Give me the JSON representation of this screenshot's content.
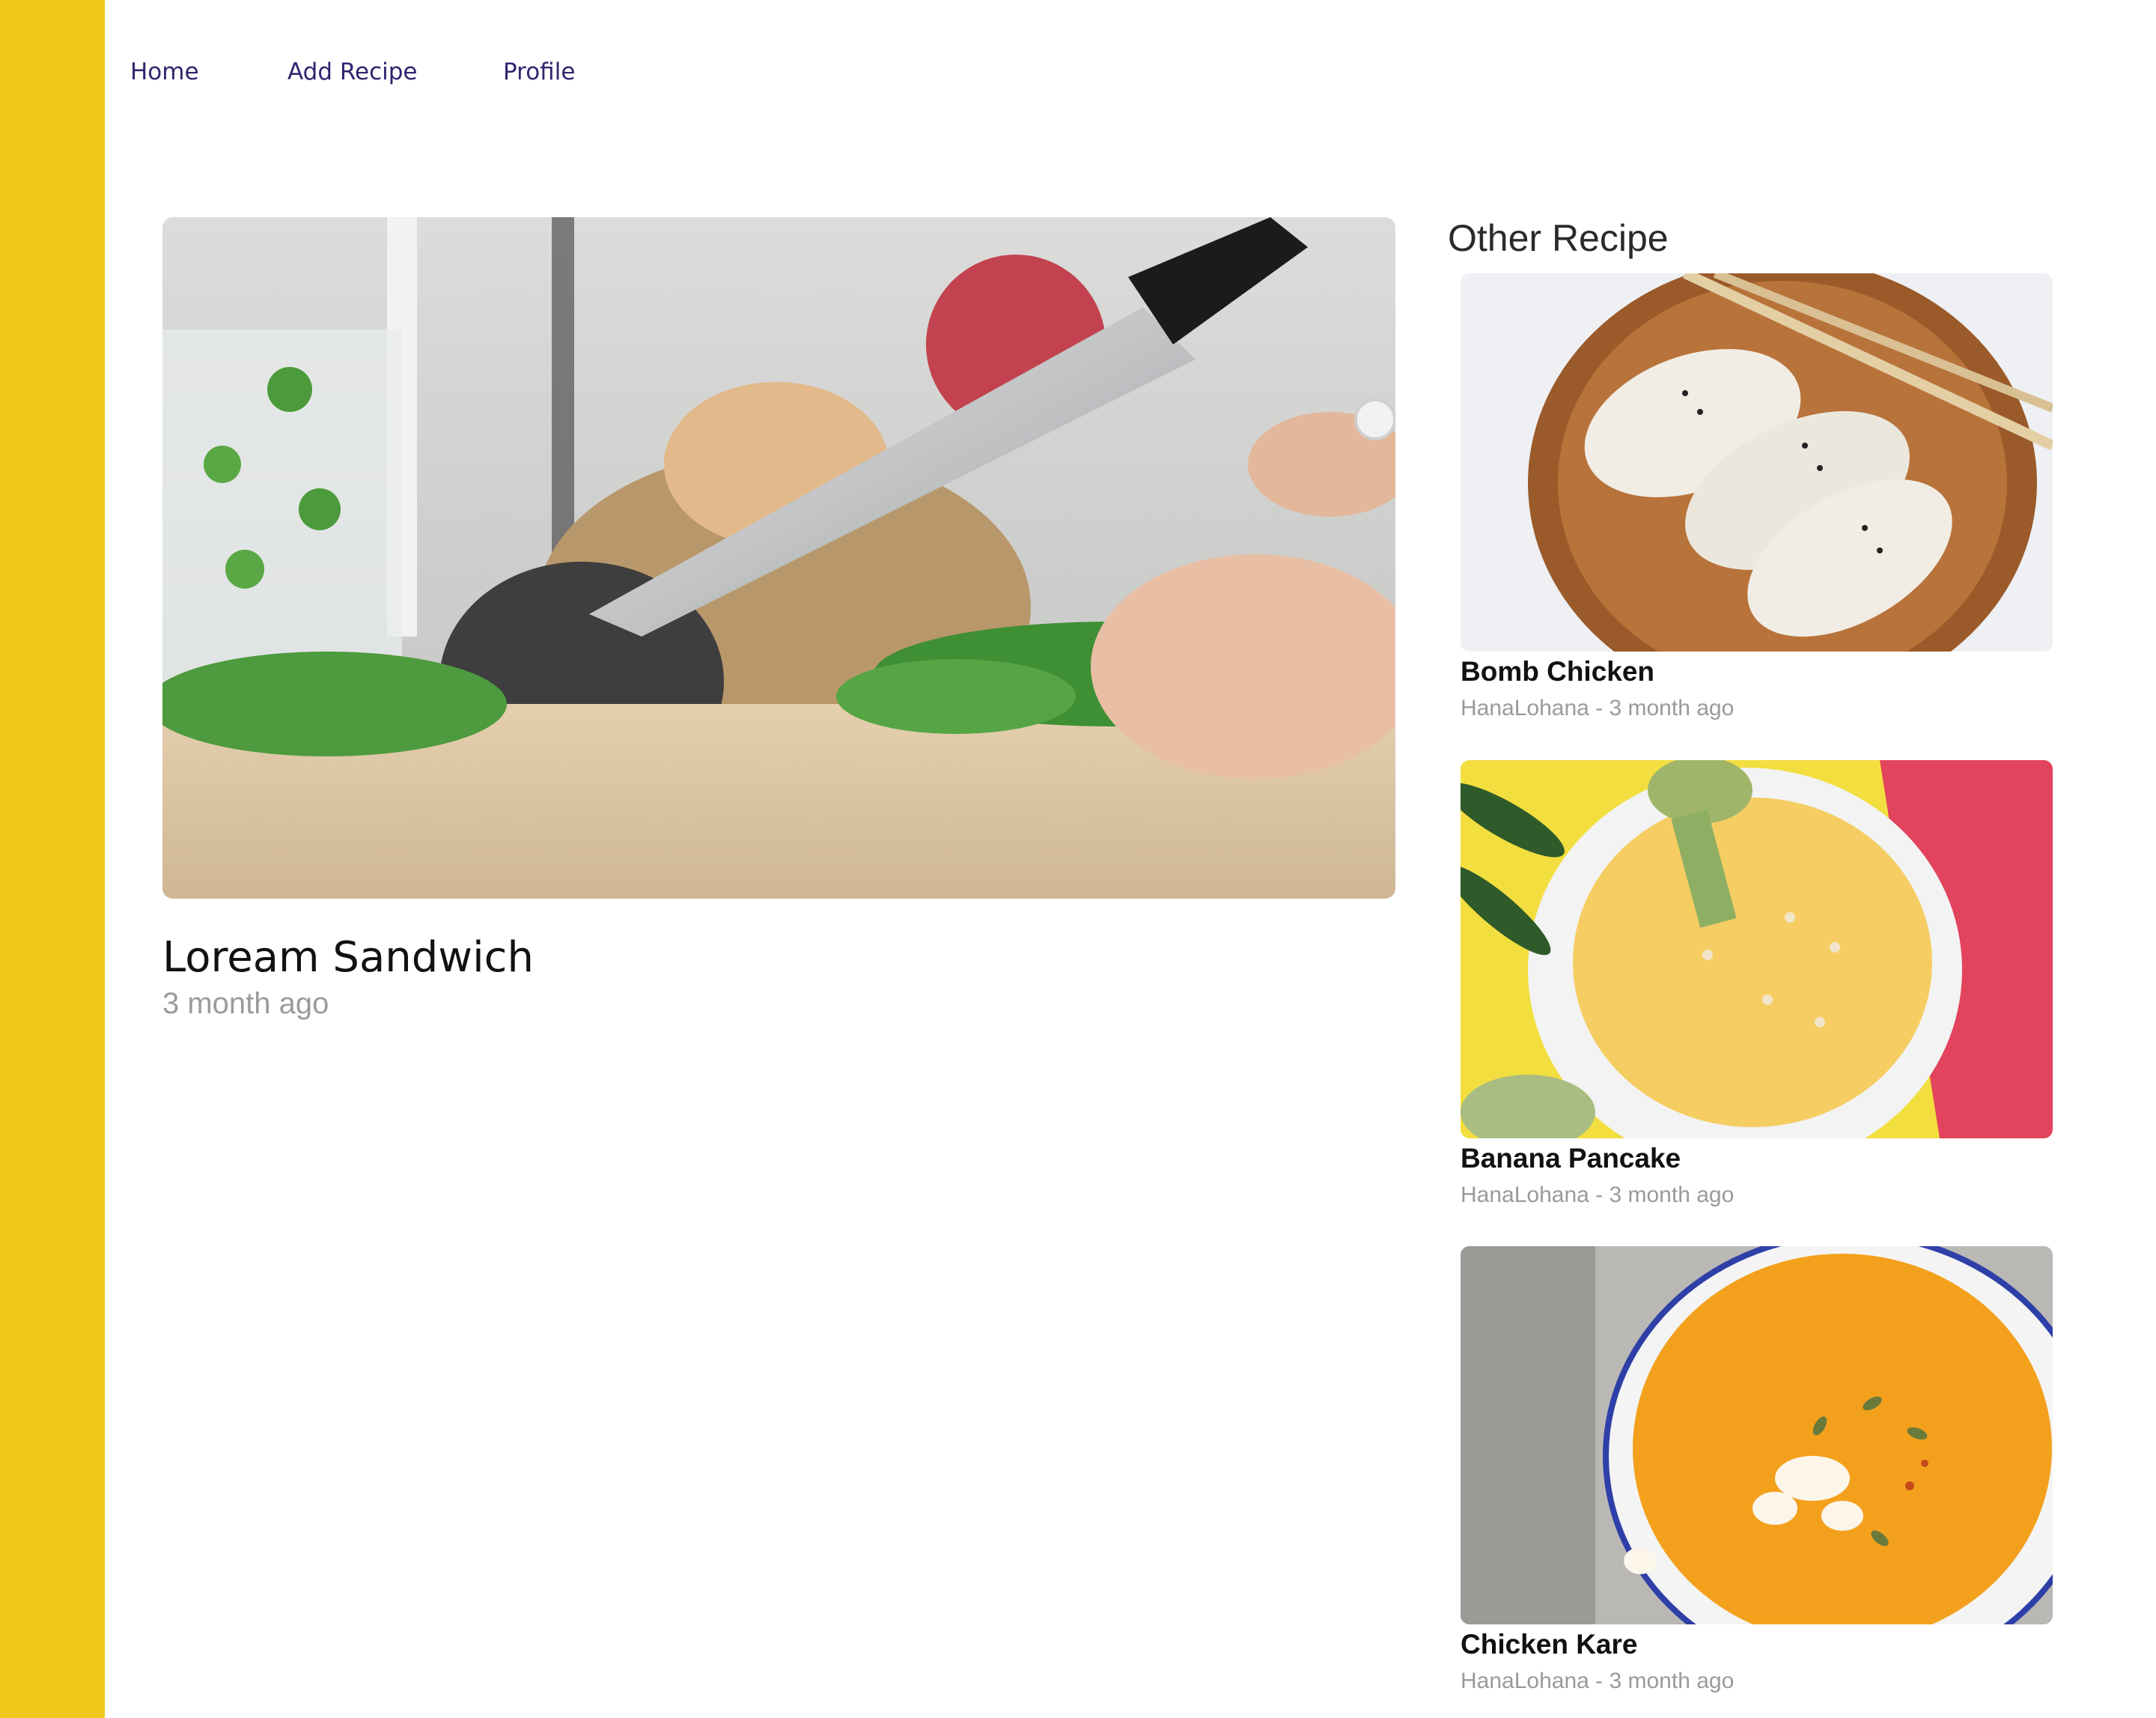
{
  "nav": {
    "home": "Home",
    "add_recipe": "Add Recipe",
    "profile": "Profile"
  },
  "featured": {
    "title": "Loream Sandwich",
    "time": "3 month ago",
    "image": "chopping-cilantro-photo"
  },
  "other": {
    "heading": "Other Recipe",
    "items": [
      {
        "title": "Bomb Chicken",
        "meta": "HanaLohana - 3 month ago",
        "image": "dumplings-photo"
      },
      {
        "title": "Banana Pancake",
        "meta": "HanaLohana - 3 month ago",
        "image": "yellow-soup-photo"
      },
      {
        "title": "Chicken Kare",
        "meta": "HanaLohana - 3 month ago",
        "image": "orange-soup-photo"
      }
    ]
  },
  "colors": {
    "sidebar": "#EFC81A",
    "nav_text": "#2E266F"
  }
}
